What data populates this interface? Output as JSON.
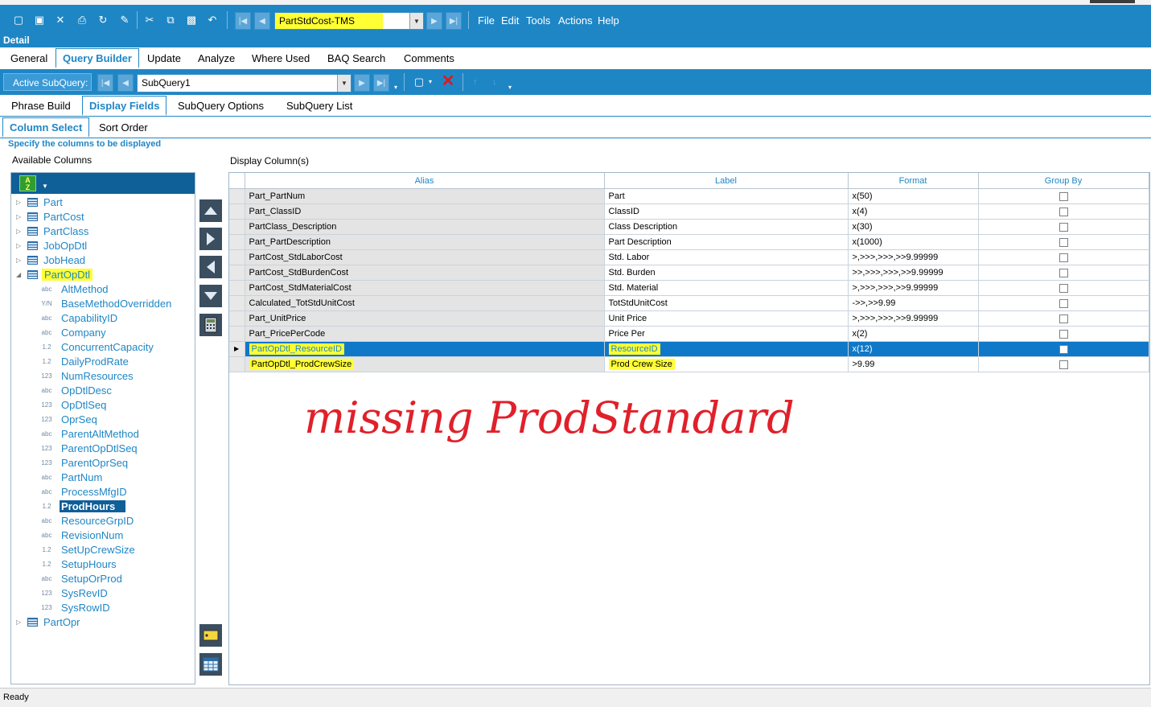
{
  "toolbar": {
    "query_name": "PartStdCost-TMS",
    "menu": [
      "File",
      "Edit",
      "Tools",
      "Actions",
      "Help"
    ]
  },
  "detail_title": "Detail",
  "main_tabs": [
    "General",
    "Query Builder",
    "Update",
    "Analyze",
    "Where Used",
    "BAQ Search",
    "Comments"
  ],
  "subquery_bar": {
    "label": "Active SubQuery:",
    "value": "SubQuery1"
  },
  "sub_tabs": [
    "Phrase Build",
    "Display Fields",
    "SubQuery Options",
    "SubQuery List"
  ],
  "field_tabs": [
    "Column Select",
    "Sort Order"
  ],
  "hint": "Specify the columns to be displayed",
  "available_columns_label": "Available Columns",
  "display_columns_label": "Display Column(s)",
  "tree": {
    "tables_before": [
      "Part",
      "PartCost",
      "PartClass",
      "JobOpDtl",
      "JobHead"
    ],
    "expanded_table": "PartOpDtl",
    "fields": [
      {
        "type": "abc",
        "name": "AltMethod"
      },
      {
        "type": "Y/N",
        "name": "BaseMethodOverridden"
      },
      {
        "type": "abc",
        "name": "CapabilityID"
      },
      {
        "type": "abc",
        "name": "Company"
      },
      {
        "type": "1.2",
        "name": "ConcurrentCapacity"
      },
      {
        "type": "1.2",
        "name": "DailyProdRate"
      },
      {
        "type": "123",
        "name": "NumResources"
      },
      {
        "type": "abc",
        "name": "OpDtlDesc"
      },
      {
        "type": "123",
        "name": "OpDtlSeq"
      },
      {
        "type": "123",
        "name": "OprSeq"
      },
      {
        "type": "abc",
        "name": "ParentAltMethod"
      },
      {
        "type": "123",
        "name": "ParentOpDtlSeq"
      },
      {
        "type": "123",
        "name": "ParentOprSeq"
      },
      {
        "type": "abc",
        "name": "PartNum"
      },
      {
        "type": "abc",
        "name": "ProcessMfgID"
      },
      {
        "type": "1.2",
        "name": "ProdHours"
      },
      {
        "type": "abc",
        "name": "ResourceGrpID"
      },
      {
        "type": "abc",
        "name": "RevisionNum"
      },
      {
        "type": "1.2",
        "name": "SetUpCrewSize"
      },
      {
        "type": "1.2",
        "name": "SetupHours"
      },
      {
        "type": "abc",
        "name": "SetupOrProd"
      },
      {
        "type": "123",
        "name": "SysRevID"
      },
      {
        "type": "123",
        "name": "SysRowID"
      }
    ],
    "tables_after": [
      "PartOpr"
    ],
    "selected_field": "ProdHours"
  },
  "grid": {
    "headers": [
      "Alias",
      "Label",
      "Format",
      "Group By"
    ],
    "rows": [
      {
        "alias": "Part_PartNum",
        "label": "Part",
        "format": "x(50)"
      },
      {
        "alias": "Part_ClassID",
        "label": "ClassID",
        "format": "x(4)"
      },
      {
        "alias": "PartClass_Description",
        "label": "Class Description",
        "format": "x(30)"
      },
      {
        "alias": "Part_PartDescription",
        "label": "Part Description",
        "format": "x(1000)"
      },
      {
        "alias": "PartCost_StdLaborCost",
        "label": "Std. Labor",
        "format": ">,>>>,>>>,>>9.99999"
      },
      {
        "alias": "PartCost_StdBurdenCost",
        "label": "Std. Burden",
        "format": ">>,>>>,>>>,>>9.99999"
      },
      {
        "alias": "PartCost_StdMaterialCost",
        "label": "Std. Material",
        "format": ">,>>>,>>>,>>9.99999"
      },
      {
        "alias": "Calculated_TotStdUnitCost",
        "label": "TotStdUnitCost",
        "format": "->>,>>9.99"
      },
      {
        "alias": "Part_UnitPrice",
        "label": "Unit Price",
        "format": ">,>>>,>>>,>>9.99999"
      },
      {
        "alias": "Part_PricePerCode",
        "label": "Price Per",
        "format": "x(2)"
      },
      {
        "alias": "PartOpDtl_ResourceID",
        "label": "ResourceID",
        "format": "x(12)"
      },
      {
        "alias": "PartOpDtl_ProdCrewSize",
        "label": "Prod Crew Size",
        "format": ">9.99"
      }
    ],
    "selected_row_index": 10
  },
  "annotation": "missing ProdStandard",
  "status": "Ready",
  "colors": {
    "accent": "#1f86c5",
    "highlight": "#ffff33",
    "selection": "#0f78c8",
    "annotation": "#e0202a"
  }
}
